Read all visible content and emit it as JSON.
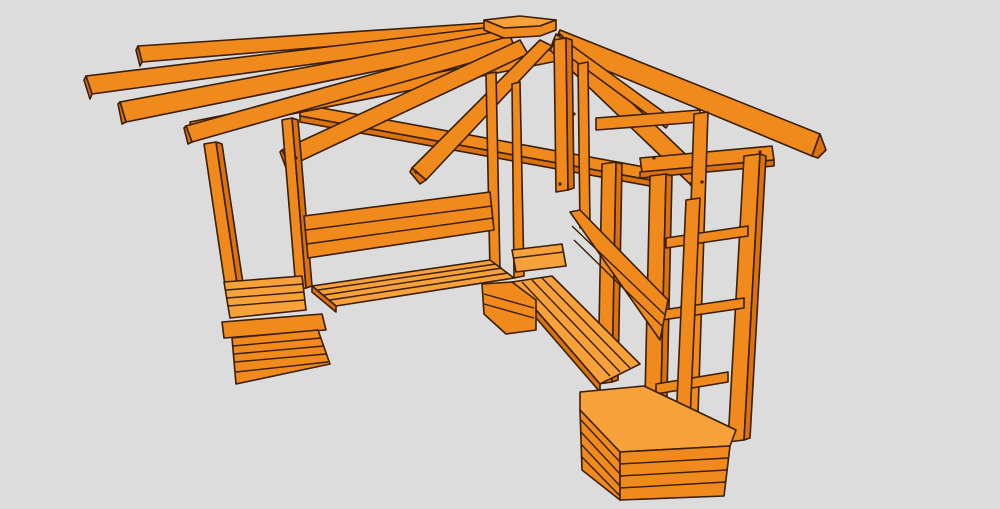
{
  "scene": {
    "background": "#dcdcdc",
    "wood_color": "#f08a1c",
    "wood_dark": "#d9720f",
    "wood_light": "#f6a13a",
    "outline_color": "#3a1e05"
  }
}
